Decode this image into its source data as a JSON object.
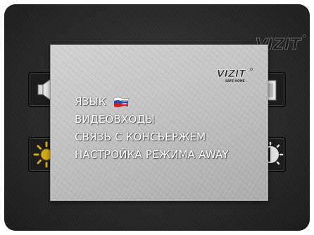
{
  "brand": {
    "logo_text": "VIZIT",
    "logo_subtext": "SAFE HOME"
  },
  "menu": {
    "items": [
      {
        "label": "ЯЗЫК",
        "flag": "russia-flag-icon"
      },
      {
        "label": "ВИДЕОВХОДЫ"
      },
      {
        "label": "СВЯЗЬ С КОНСЬЕРЖЕМ"
      },
      {
        "label": "НАСТРОЙКА РЕЖИМА AWAY"
      }
    ]
  },
  "background_icons": [
    "speaker-icon",
    "brightness-icon",
    "door-icon",
    "contrast-icon"
  ],
  "colors": {
    "menu_text": "#ffffff",
    "panel": "#c4c4c4",
    "screen_background": "#2e2e2e",
    "flag_white": "#ffffff",
    "flag_blue": "#1f4fbf",
    "flag_red": "#d22020"
  }
}
